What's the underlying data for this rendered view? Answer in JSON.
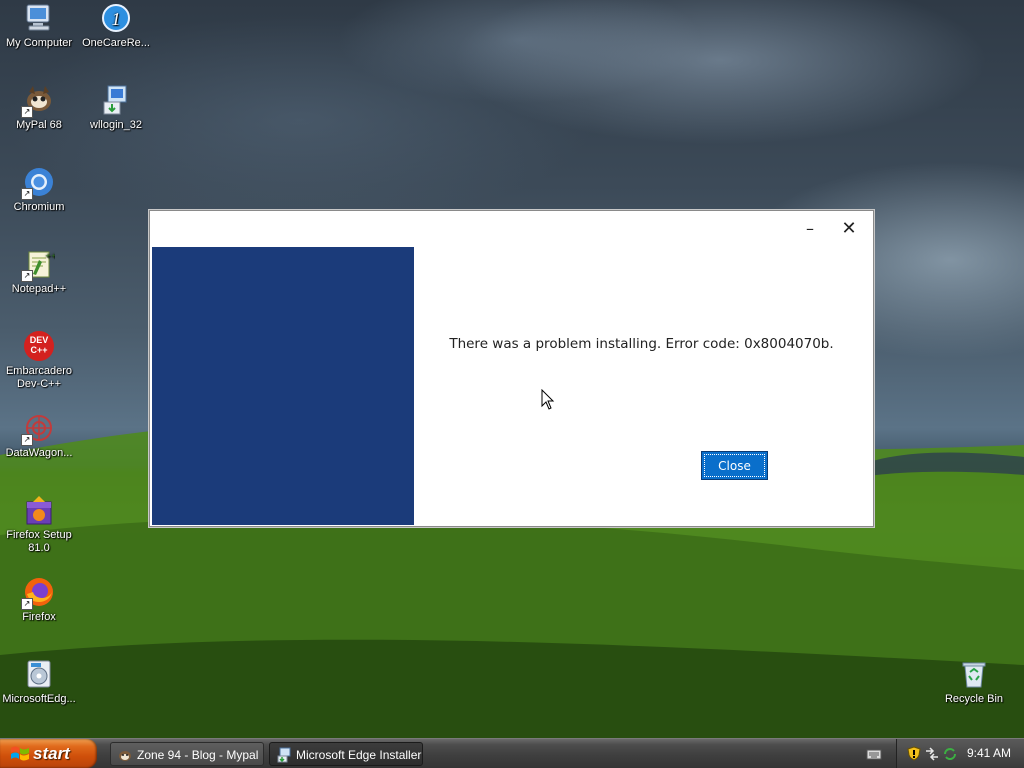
{
  "desktop": {
    "icons": [
      {
        "label": "My Computer",
        "icon": "computer-icon"
      },
      {
        "label": "OneCareRe...",
        "icon": "onecare-icon"
      },
      {
        "label": "MyPal 68",
        "icon": "mypal-icon"
      },
      {
        "label": "wllogin_32",
        "icon": "installer-icon"
      },
      {
        "label": "Chromium",
        "icon": "chromium-icon"
      },
      {
        "label": "Notepad++",
        "icon": "notepadpp-icon"
      },
      {
        "label": "Embarcadero Dev-C++",
        "icon": "devcpp-icon"
      },
      {
        "label": "DataWagon...",
        "icon": "datawagon-icon"
      },
      {
        "label": "Firefox Setup 81.0",
        "icon": "firefox-setup-icon"
      },
      {
        "label": "Firefox",
        "icon": "firefox-icon"
      },
      {
        "label": "MicrosoftEdg...",
        "icon": "edge-installer-icon"
      },
      {
        "label": "Recycle Bin",
        "icon": "recycle-bin-icon"
      }
    ],
    "devcpp_badge": "DEV C++"
  },
  "dialog": {
    "message": "There was a problem installing. Error code: 0x8004070b.",
    "close_label": "Close",
    "minimize_glyph": "–",
    "close_glyph": "✕",
    "panel_color": "#1b3b7a",
    "button_color": "#0a6fcb"
  },
  "taskbar": {
    "start_label": "start",
    "tasks": [
      {
        "label": "Zone 94 - Blog - Mypal",
        "icon": "mypal-icon"
      },
      {
        "label": "Microsoft Edge Installer",
        "icon": "installer-icon"
      }
    ],
    "clock": "9:41 AM"
  }
}
